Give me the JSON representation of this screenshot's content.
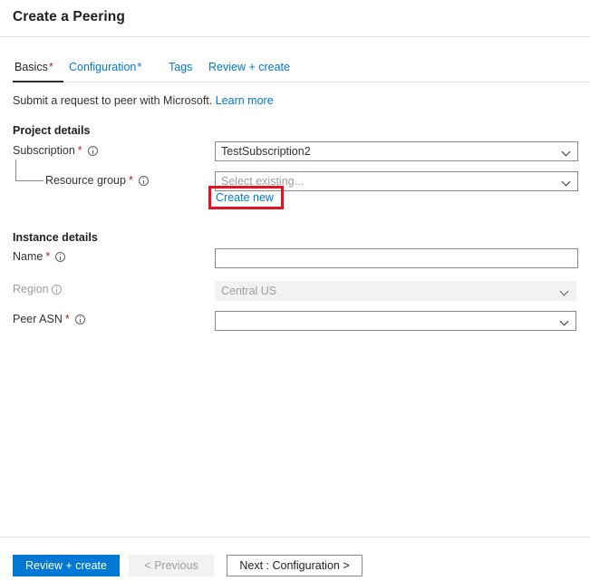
{
  "header": {
    "title": "Create a Peering"
  },
  "tabs": [
    {
      "label": "Basics",
      "required": "*",
      "active": true
    },
    {
      "label": "Configuration",
      "required": "*",
      "active": false
    },
    {
      "label": "Tags",
      "required": "",
      "active": false
    },
    {
      "label": "Review + create",
      "required": "",
      "active": false
    }
  ],
  "subtitle": {
    "text": "Submit a request to peer with Microsoft.",
    "link_label": "Learn more"
  },
  "sections": {
    "project_details": {
      "title": "Project details",
      "fields": {
        "subscription": {
          "label": "Subscription",
          "required": "*",
          "value": "TestSubscription2",
          "icon": "info-icon",
          "chevron": "chevron-down-icon"
        },
        "resource_group": {
          "label": "Resource group",
          "required": "*",
          "value": "",
          "placeholder": "Select existing...",
          "icon": "info-icon",
          "chevron": "chevron-down-icon",
          "create_new_label": "Create new"
        }
      }
    },
    "instance_details": {
      "title": "Instance details",
      "fields": {
        "name": {
          "label": "Name",
          "required": "*",
          "value": "",
          "placeholder": "",
          "icon": "info-icon"
        },
        "region": {
          "label": "Region",
          "required": "",
          "value": "Central US",
          "disabled": true,
          "icon": "info-icon",
          "chevron": "chevron-down-icon"
        },
        "peer_asn": {
          "label": "Peer ASN",
          "required": "*",
          "value": "",
          "placeholder": "",
          "icon": "info-icon",
          "chevron": "chevron-down-icon"
        }
      }
    }
  },
  "footer": {
    "review_create_label": "Review + create",
    "previous_label": "< Previous",
    "next_label": "Next : Configuration >"
  },
  "annotation": {
    "type": "highlight-rectangle",
    "target": "Create new",
    "color": "#e81123"
  },
  "colors": {
    "accent": "#0078d4",
    "required_asterisk": "#a4262c",
    "text": "#323130",
    "disabled_text": "#a19f9d",
    "border": "#8a8886",
    "divider": "#e1e1e1",
    "disabled_bg": "#f3f2f1",
    "annotation": "#e81123"
  }
}
